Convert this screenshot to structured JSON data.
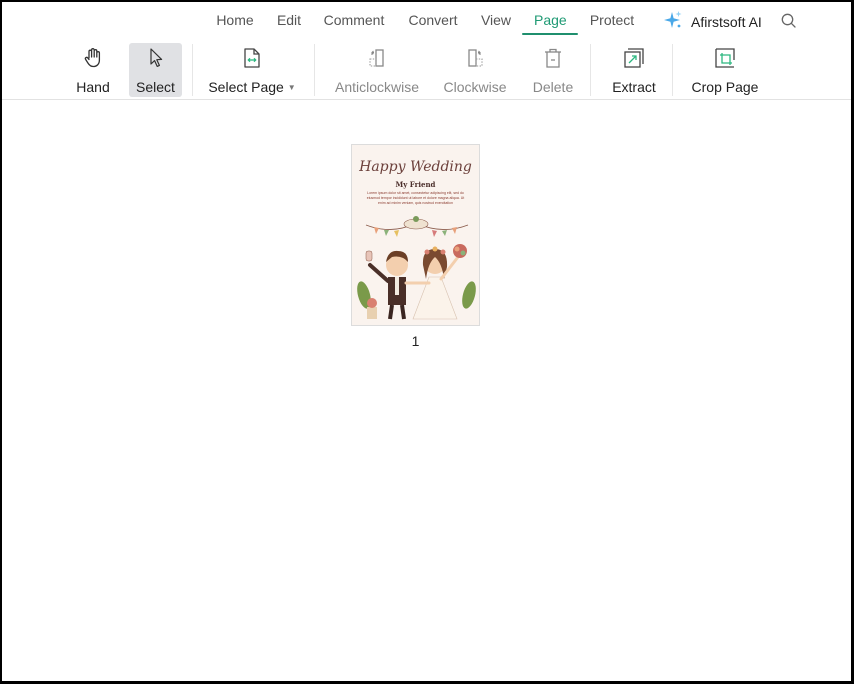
{
  "menu": {
    "tabs": [
      {
        "label": "Home"
      },
      {
        "label": "Edit"
      },
      {
        "label": "Comment"
      },
      {
        "label": "Convert"
      },
      {
        "label": "View"
      },
      {
        "label": "Page",
        "active": true
      },
      {
        "label": "Protect"
      }
    ],
    "ai_label": "Afirstsoft AI"
  },
  "toolbar": {
    "hand": "Hand",
    "select": "Select",
    "select_page": "Select Page",
    "anticlockwise": "Anticlockwise",
    "clockwise": "Clockwise",
    "delete": "Delete",
    "extract": "Extract",
    "crop_page": "Crop Page"
  },
  "document": {
    "pages": [
      {
        "number": "1",
        "title": "Happy Wedding",
        "subtitle": "My Friend",
        "body": "Lorem ipsum dolor sit amet, consectetur adipiscing elit, sed do eiusmod tempor incididunt ut labore et dolore magna aliqua. Ut enim ad minim veniam, quis nostrud exercitation"
      }
    ]
  },
  "colors": {
    "accent": "#1f9a74",
    "selected_bg": "#e0e1e4"
  }
}
